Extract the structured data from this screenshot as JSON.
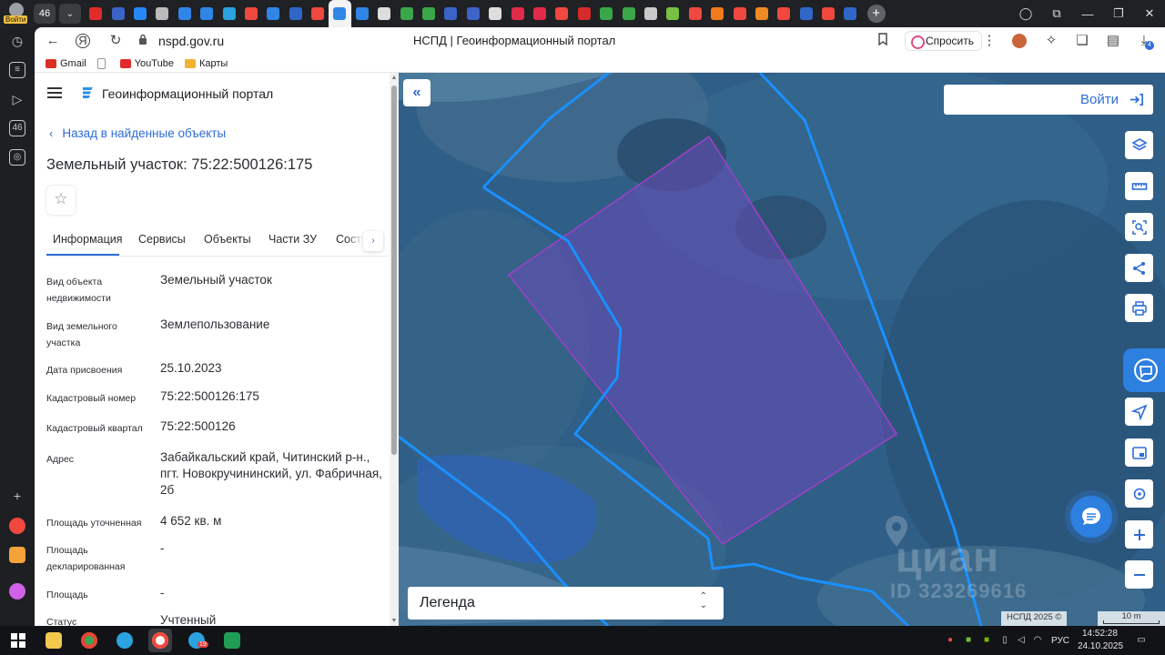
{
  "browser": {
    "profile_label": "Войти",
    "tab_count": "46",
    "url": "nspd.gov.ru",
    "page_title": "НСПД | Геоинформационный портал",
    "ask_label": "Спросить",
    "downloads_badge": "4",
    "left_badge": "46",
    "tab_favicons": [
      {
        "icon": "red-youtube-icon",
        "color": "#e22b2b"
      },
      {
        "icon": "russian-flag-icon",
        "color": "#3b63c8"
      },
      {
        "icon": "vk-icon",
        "color": "#2787f5"
      },
      {
        "icon": "back-arrow-icon",
        "color": "#bbbbbb"
      },
      {
        "icon": "blue-doc-icon",
        "color": "#2f86e6"
      },
      {
        "icon": "skype-icon",
        "color": "#2f86e6"
      },
      {
        "icon": "telegram-icon",
        "color": "#2aa3e0"
      },
      {
        "icon": "yandex-icon",
        "color": "#f0483e"
      },
      {
        "icon": "nspd-icon",
        "color": "#2f86e6"
      },
      {
        "icon": "emblem-icon",
        "color": "#2f66c8"
      },
      {
        "icon": "yandex-icon",
        "color": "#f0483e"
      },
      {
        "icon": "nspd-icon-active",
        "color": "#2f86e6"
      },
      {
        "icon": "nspd-icon",
        "color": "#2f86e6"
      },
      {
        "icon": "star-icon",
        "color": "#dddddd"
      },
      {
        "icon": "gosuslugi-icon",
        "color": "#3aa64a"
      },
      {
        "icon": "gosuslugi-icon",
        "color": "#3aa64a"
      },
      {
        "icon": "russian-flag-icon",
        "color": "#3b63c8"
      },
      {
        "icon": "russian-flag-icon",
        "color": "#3b63c8"
      },
      {
        "icon": "gear-icon",
        "color": "#dddddd"
      },
      {
        "icon": "heart-icon",
        "color": "#e22b4b"
      },
      {
        "icon": "heart-icon",
        "color": "#e22b4b"
      },
      {
        "icon": "yandex-icon",
        "color": "#f0483e"
      },
      {
        "icon": "rts-icon",
        "color": "#d42a2a"
      },
      {
        "icon": "gosuslugi-icon",
        "color": "#3aa64a"
      },
      {
        "icon": "gosuslugi-icon",
        "color": "#3aa64a"
      },
      {
        "icon": "pdf-icon",
        "color": "#c9c9c9"
      },
      {
        "icon": "android-icon",
        "color": "#76c043"
      },
      {
        "icon": "yandex-icon",
        "color": "#f0483e"
      },
      {
        "icon": "dns-icon",
        "color": "#f07a1c"
      },
      {
        "icon": "yandex-icon",
        "color": "#f0483e"
      },
      {
        "icon": "orange-round-icon",
        "color": "#f08a24"
      },
      {
        "icon": "yandex-icon",
        "color": "#f0483e"
      },
      {
        "icon": "emblem-icon",
        "color": "#2f66c8"
      },
      {
        "icon": "yandex-icon",
        "color": "#f0483e"
      },
      {
        "icon": "emblem-icon",
        "color": "#2f66c8"
      }
    ]
  },
  "bookmarks": [
    {
      "label": "Gmail",
      "icon": "gmail-icon",
      "color": "#d93025"
    },
    {
      "label": "",
      "icon": "blank-page-icon",
      "color": "#ffffff"
    },
    {
      "label": "YouTube",
      "icon": "youtube-icon",
      "color": "#e22b2b"
    },
    {
      "label": "Карты",
      "icon": "maps-pin-icon",
      "color": "#f2b233"
    }
  ],
  "portal": {
    "name": "Геоинформационный портал",
    "back_label": "Назад в найденные объекты",
    "object_title": "Земельный участок: 75:22:500126:175",
    "tabs": [
      "Информация",
      "Сервисы",
      "Объекты",
      "Части ЗУ",
      "Соста"
    ],
    "info": [
      {
        "label": "Вид объекта недвижимости",
        "value": "Земельный участок"
      },
      {
        "label": "Вид земельного участка",
        "value": "Землепользование"
      },
      {
        "label": "Дата присвоения",
        "value": "25.10.2023"
      },
      {
        "label": "Кадастровый номер",
        "value": "75:22:500126:175"
      },
      {
        "label": "Кадастровый квартал",
        "value": "75:22:500126"
      },
      {
        "label": "Адрес",
        "value": "Забайкальский край, Читинский р-н., пгт. Новокручининский, ул. Фабричная, 2б"
      },
      {
        "label": "Площадь уточненная",
        "value": "4 652 кв. м"
      },
      {
        "label": "Площадь декларированная",
        "value": "-"
      },
      {
        "label": "Площадь",
        "value": "-"
      },
      {
        "label": "Статус",
        "value": "Учтенный"
      }
    ]
  },
  "map": {
    "login_label": "Войти",
    "legend_label": "Легенда",
    "attribution": "НСПД 2025 ©",
    "scale_label": "10 m",
    "watermark_brand": "циан",
    "watermark_id": "ID 323269616",
    "colors": {
      "boundary": "#1a90ff",
      "parcel": "#a040c8",
      "accent": "#2d7fe0"
    }
  },
  "taskbar": {
    "time": "14:52:28",
    "date": "24.10.2025",
    "lang": "РУС",
    "telegram_badge": "19"
  }
}
